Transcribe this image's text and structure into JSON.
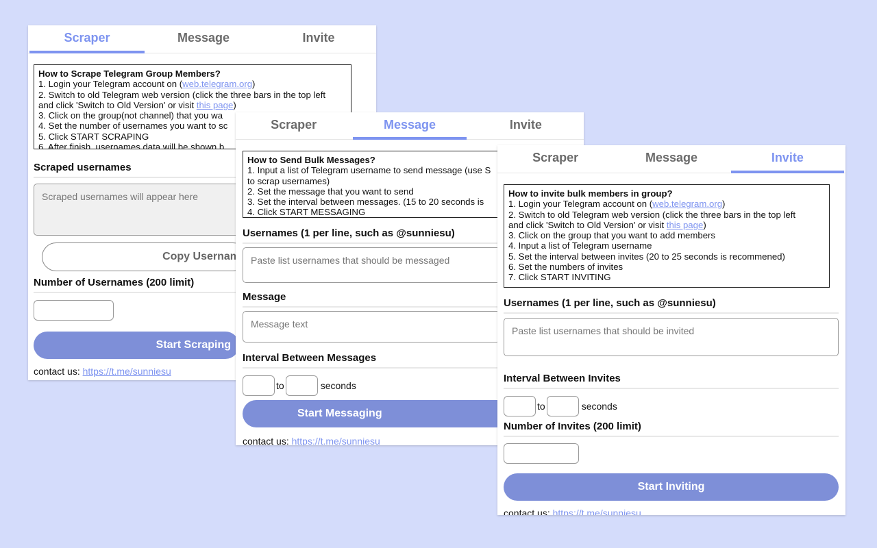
{
  "tabs": [
    "Scraper",
    "Message",
    "Invite"
  ],
  "scraper": {
    "howto_title": "How to Scrape Telegram Group Members?",
    "step1_pre": "1. Login your Telegram account on (",
    "step1_link": "web.telegram.org",
    "step1_post": ")",
    "step2a": "2. Switch to old Telegram web version (click the three bars in the top left",
    "step2b_pre": "and click 'Switch to Old Version' or visit ",
    "step2b_link": "this page",
    "step2b_post": ")",
    "step3": "3. Click on the group(not channel) that you wa",
    "step4": "4. Set the number of usernames you want to sc",
    "step5": "5. Click START SCRAPING",
    "step6": "6. After finish, usernames data will be shown b",
    "scraped_label": "Scraped usernames",
    "scraped_placeholder": "Scraped usernames will appear here",
    "copy_button": "Copy Usernam",
    "number_label": "Number of Usernames (200 limit)",
    "start_button": "Start Scraping",
    "contact_label": "contact us: ",
    "contact_link": "https://t.me/sunniesu"
  },
  "message": {
    "howto_title": "How to Send Bulk Messages?",
    "step1a": "1. Input a list of Telegram username to send message (use S",
    "step1b": "to scrap usernames)",
    "step2": "2. Set the message that you want to send",
    "step3": "3. Set the interval between messages. (15 to 20 seconds is",
    "step4": "4. Click START MESSAGING",
    "usernames_label": "Usernames (1 per line, such as @sunniesu)",
    "usernames_placeholder": "Paste list usernames that should be messaged",
    "message_label": "Message",
    "message_placeholder": "Message text",
    "interval_label": "Interval Between Messages",
    "to_label": "to",
    "seconds_label": "seconds",
    "start_button": "Start Messaging",
    "contact_label": "contact us: ",
    "contact_link": "https://t.me/sunniesu"
  },
  "invite": {
    "howto_title": "How to invite bulk members in group?",
    "step1_pre": "1. Login your Telegram account on (",
    "step1_link": "web.telegram.org",
    "step1_post": ")",
    "step2a": "2. Switch to old Telegram web version (click the three bars in the top left",
    "step2b_pre": "and click 'Switch to Old Version' or visit ",
    "step2b_link": "this page",
    "step2b_post": ")",
    "step3": "3. Click on the group that you want to add members",
    "step4": "4. Input a list of Telegram username",
    "step5": "5. Set the interval between invites (20 to 25 seconds is recommened)",
    "step6": "6. Set the numbers of invites",
    "step7": "7. Click START INVITING",
    "usernames_label": "Usernames (1 per line, such as @sunniesu)",
    "usernames_placeholder": "Paste list usernames that should be invited",
    "interval_label": "Interval Between Invites",
    "to_label": "to",
    "seconds_label": "seconds",
    "number_label": "Number of Invites (200 limit)",
    "start_button": "Start Inviting",
    "contact_label": "contact us: ",
    "contact_link": "https://t.me/sunniesu"
  },
  "colors": {
    "background": "#d4dcfb",
    "accent": "#7e94f0",
    "button": "#7e8fd8"
  }
}
